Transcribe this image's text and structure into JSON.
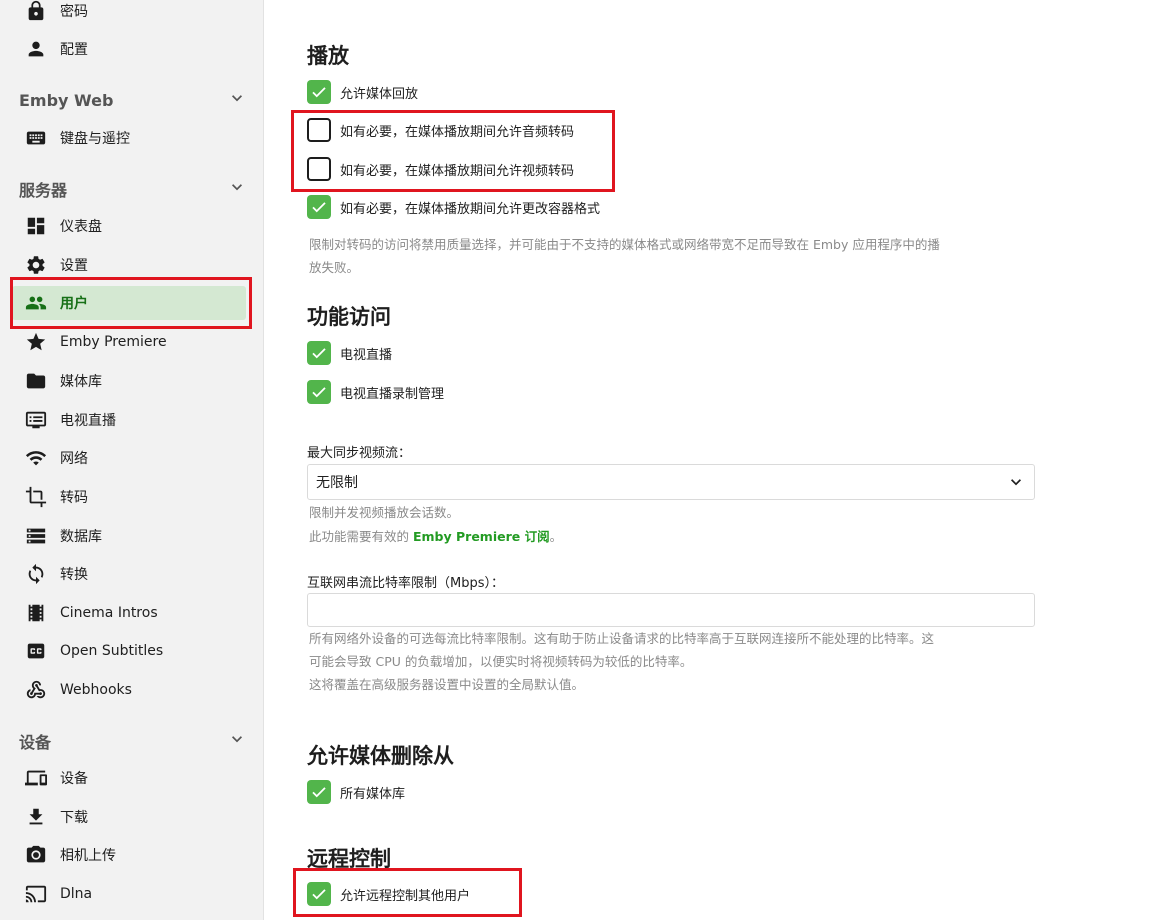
{
  "sidebar": {
    "top_items": [
      {
        "label": "密码",
        "icon": "lock-icon"
      },
      {
        "label": "配置",
        "icon": "person-icon"
      }
    ],
    "emby_web": {
      "header": "Emby Web",
      "items": [
        {
          "label": "键盘与遥控",
          "icon": "keyboard-icon"
        }
      ]
    },
    "server": {
      "header": "服务器",
      "items": [
        {
          "label": "仪表盘",
          "icon": "dashboard-icon"
        },
        {
          "label": "设置",
          "icon": "gear-icon"
        },
        {
          "label": "用户",
          "icon": "people-icon",
          "active": true
        },
        {
          "label": "Emby Premiere",
          "icon": "star-icon"
        },
        {
          "label": "媒体库",
          "icon": "folder-icon"
        },
        {
          "label": "电视直播",
          "icon": "tv-guide-icon"
        },
        {
          "label": "网络",
          "icon": "wifi-icon"
        },
        {
          "label": "转码",
          "icon": "crop-icon"
        },
        {
          "label": "数据库",
          "icon": "database-icon"
        },
        {
          "label": "转换",
          "icon": "sync-icon"
        },
        {
          "label": "Cinema Intros",
          "icon": "film-icon"
        },
        {
          "label": "Open Subtitles",
          "icon": "closed-caption-icon"
        },
        {
          "label": "Webhooks",
          "icon": "webhook-icon"
        }
      ]
    },
    "devices": {
      "header": "设备",
      "items": [
        {
          "label": "设备",
          "icon": "devices-icon"
        },
        {
          "label": "下载",
          "icon": "download-icon"
        },
        {
          "label": "相机上传",
          "icon": "camera-icon"
        },
        {
          "label": "Dlna",
          "icon": "cast-icon"
        }
      ]
    }
  },
  "main": {
    "playback": {
      "title": "播放",
      "options": [
        {
          "label": "允许媒体回放",
          "checked": true
        },
        {
          "label": "如有必要，在媒体播放期间允许音频转码",
          "checked": false
        },
        {
          "label": "如有必要，在媒体播放期间允许视频转码",
          "checked": false
        },
        {
          "label": "如有必要，在媒体播放期间允许更改容器格式",
          "checked": true
        }
      ],
      "hint_line1": "限制对转码的访问将禁用质量选择，并可能由于不支持的媒体格式或网络带宽不足而导致在 Emby 应用程序中的播",
      "hint_line2": "放失败。"
    },
    "feature_access": {
      "title": "功能访问",
      "options": [
        {
          "label": "电视直播",
          "checked": true
        },
        {
          "label": "电视直播录制管理",
          "checked": true
        }
      ]
    },
    "max_streams": {
      "label": "最大同步视频流：",
      "value": "无限制",
      "hint1": "限制并发视频播放会话数。",
      "hint2_prefix": "此功能需要有效的 ",
      "hint2_link": "Emby Premiere 订阅",
      "hint2_suffix": "。"
    },
    "bitrate": {
      "label": "互联网串流比特率限制（Mbps）：",
      "value": "",
      "hint1": "所有网络外设备的可选每流比特率限制。这有助于防止设备请求的比特率高于互联网连接所不能处理的比特率。这",
      "hint2": "可能会导致 CPU 的负载增加，以便实时将视频转码为较低的比特率。",
      "hint3": "这将覆盖在高级服务器设置中设置的全局默认值。"
    },
    "deletion": {
      "title": "允许媒体删除从",
      "options": [
        {
          "label": "所有媒体库",
          "checked": true
        }
      ]
    },
    "remote_control": {
      "title": "远程控制",
      "options": [
        {
          "label": "允许远程控制其他用户",
          "checked": true
        }
      ]
    }
  },
  "colors": {
    "accent_green": "#52b54b",
    "active_bg": "#d4e8d2",
    "active_text": "#177017",
    "highlight_red": "#e0151f"
  }
}
